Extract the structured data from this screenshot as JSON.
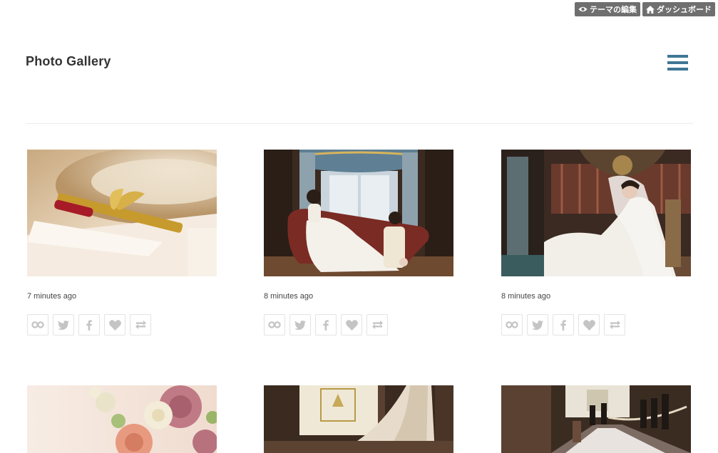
{
  "admin_bar": {
    "edit_theme_label": "テーマの編集",
    "dashboard_label": "ダッシュボード"
  },
  "site": {
    "title": "Photo  Gallery"
  },
  "posts": [
    {
      "time": "7 minutes ago",
      "photo": "gold-pen-on-plate"
    },
    {
      "time": "8 minutes ago",
      "photo": "couple-on-sofa"
    },
    {
      "time": "8 minutes ago",
      "photo": "bride-in-chair"
    },
    {
      "time": "",
      "photo": "rose-bouquet"
    },
    {
      "time": "",
      "photo": "wedding-dress-train"
    },
    {
      "time": "",
      "photo": "chapel-aisle"
    }
  ],
  "actions": [
    "permalink-icon",
    "twitter-icon",
    "facebook-icon",
    "like-icon",
    "reblog-icon"
  ],
  "colors": {
    "accent": "#3f7694",
    "admin_bg": "#6f6f6f",
    "icon_gray": "#c4c4c4"
  }
}
